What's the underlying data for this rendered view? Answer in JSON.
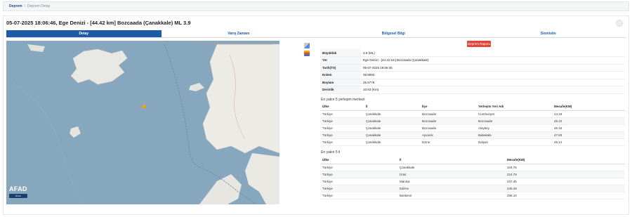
{
  "breadcrumb": {
    "home": "Deprem",
    "current": "Deprem Detay"
  },
  "title": "05-07-2025 18:06:46, Ege Denizi - [44.42 km] Bozcaada (Çanakkale) ML 3.9",
  "tabs": [
    {
      "label": "Detay",
      "active": true
    },
    {
      "label": "Varış Zamanı",
      "active": false
    },
    {
      "label": "Bölgesel Bilgi",
      "active": false
    },
    {
      "label": "Sismisite",
      "active": false
    }
  ],
  "report_button": "Deprem Raporu",
  "map": {
    "logo": "AFAD",
    "scale_label": "20 km"
  },
  "info": [
    {
      "key": "Büyüklük",
      "value": "3.9 (ML)"
    },
    {
      "key": "Yer",
      "value": "Ege Denizi - [44.42 km] Bozcaada (Çanakkale)"
    },
    {
      "key": "Tarih(TS)",
      "value": "05-07-2025 18:06:46"
    },
    {
      "key": "Enlem",
      "value": "39.8083"
    },
    {
      "key": "Boylam",
      "value": "25.5778"
    },
    {
      "key": "Derinlik",
      "value": "10.83 (Km)"
    }
  ],
  "settlements": {
    "label": "En yakın 5 yerleşim merkezi",
    "headers": [
      "Ülke",
      "İl",
      "İlçe",
      "Yerleşim Yeri Adı",
      "Mesafe(KM)"
    ],
    "rows": [
      [
        "Türkiye",
        "Çanakkale",
        "Bozcaada",
        "Cumhuriyet",
        "44.18"
      ],
      [
        "Türkiye",
        "Çanakkale",
        "Bozcaada",
        "Bozcaada",
        "45.10"
      ],
      [
        "Türkiye",
        "Çanakkale",
        "Bozcaada",
        "Alaybey",
        "45.16"
      ],
      [
        "Türkiye",
        "Çanakkale",
        "Ayvacık",
        "Babakale",
        "47.83"
      ],
      [
        "Türkiye",
        "Çanakkale",
        "Ezine",
        "Dalyan",
        "49.14"
      ]
    ]
  },
  "provinces": {
    "label": "En yakın 5 il",
    "headers": [
      "Ülke",
      "İl",
      "Mesafe(KM)"
    ],
    "rows": [
      [
        "Türkiye",
        "Çanakkale",
        "104.76"
      ],
      [
        "Türkiye",
        "İzmir",
        "224.79"
      ],
      [
        "Türkiye",
        "Manisa",
        "237.45"
      ],
      [
        "Türkiye",
        "Edirne",
        "245.49"
      ],
      [
        "Türkiye",
        "Balıkesir",
        "256.10"
      ]
    ]
  },
  "colors": {
    "brand": "#1d5aa8",
    "report": "#e0453a",
    "star": "#f5a300"
  }
}
